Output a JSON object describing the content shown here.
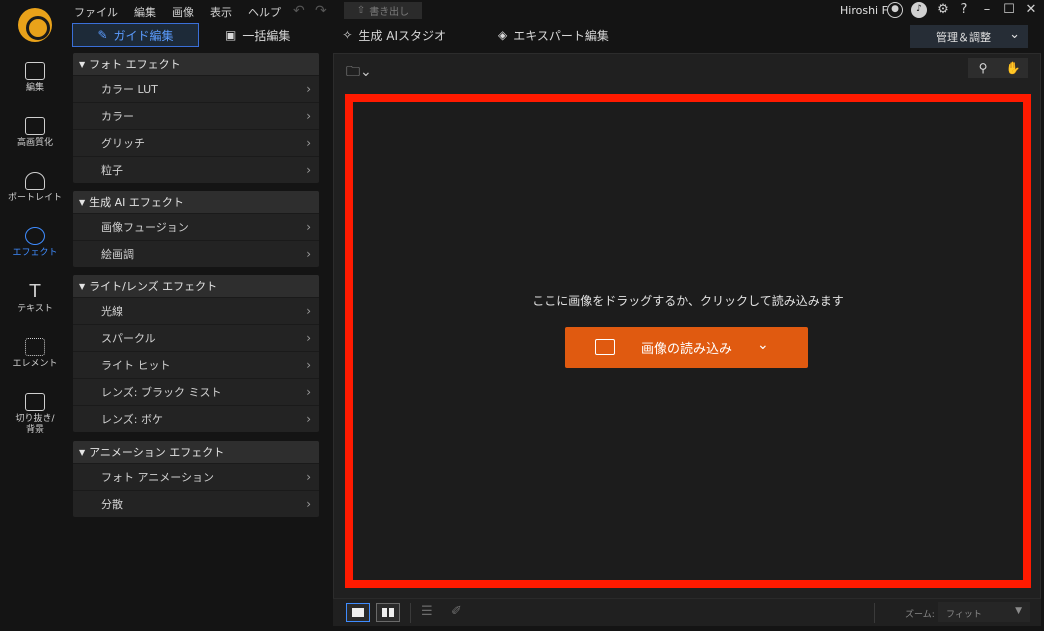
{
  "menu": [
    "ファイル",
    "編集",
    "画像",
    "表示",
    "ヘルプ"
  ],
  "export_label": "書き出し",
  "user_name": "Hiroshi F",
  "help_glyph": "?",
  "tabs": [
    {
      "label": "ガイド編集",
      "icon": "wand-icon"
    },
    {
      "label": "一括編集",
      "icon": "images-icon"
    },
    {
      "label": "生成 AIスタジオ",
      "icon": "sparkle-icon"
    },
    {
      "label": "エキスパート編集",
      "icon": "layers-icon"
    }
  ],
  "manage_label": "管理＆調整",
  "rail": [
    {
      "label": "編集",
      "icon": "photo-edit-icon"
    },
    {
      "label": "高画質化",
      "icon": "enhance-icon"
    },
    {
      "label": "ポートレイト",
      "icon": "portrait-icon"
    },
    {
      "label": "エフェクト",
      "icon": "effects-icon"
    },
    {
      "label": "テキスト",
      "icon": "text-icon"
    },
    {
      "label": "エレメント",
      "icon": "element-icon"
    },
    {
      "label": "切り抜き/\n背景",
      "icon": "cutout-icon"
    }
  ],
  "groups": [
    {
      "title": "フォト エフェクト",
      "items": [
        "カラー LUT",
        "カラー",
        "グリッチ",
        "粒子"
      ]
    },
    {
      "title": "生成 AI エフェクト",
      "items": [
        "画像フュージョン",
        "絵画調"
      ]
    },
    {
      "title": "ライト/レンズ エフェクト",
      "items": [
        "光線",
        "スパークル",
        "ライト ヒット",
        "レンズ: ブラック ミスト",
        "レンズ: ボケ"
      ]
    },
    {
      "title": "アニメーション エフェクト",
      "items": [
        "フォト アニメーション",
        "分散"
      ]
    }
  ],
  "drop_text": "ここに画像をドラッグするか、クリックして読み込みます",
  "load_button": "画像の読み込み",
  "zoom_label": "ズーム:",
  "zoom_value": "フィット",
  "accent": "#3f8cff",
  "load_color": "#e05a10",
  "highlight_color": "#ff1a00"
}
